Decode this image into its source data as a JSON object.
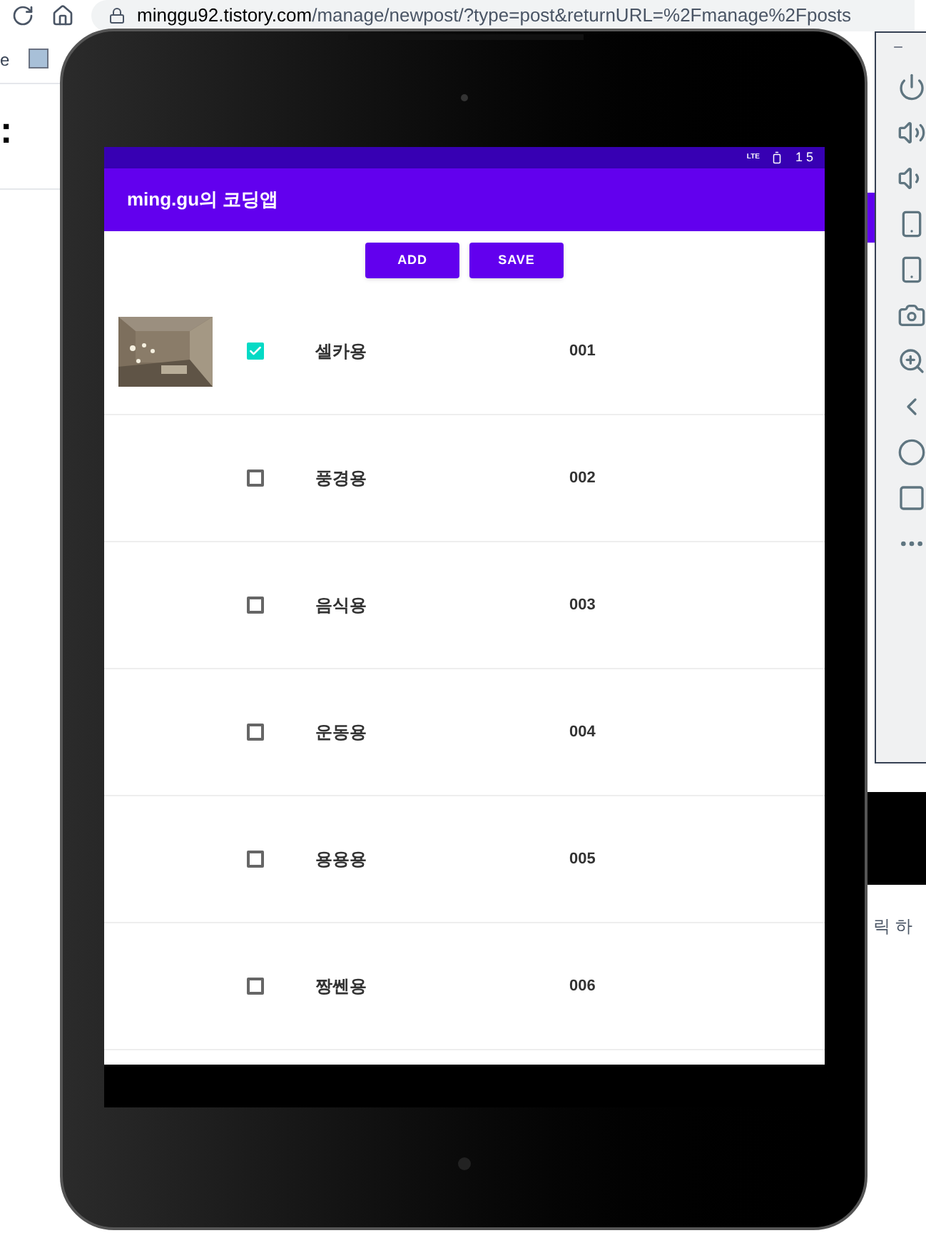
{
  "browser": {
    "url_host": "minggu92.tistory.com",
    "url_path": "/manage/newpost/?type=post&returnURL=%2Fmanage%2Fposts",
    "bookmark": "e"
  },
  "page": {
    "mark": ":",
    "caption": "릭 하"
  },
  "emulator_toolbar": {
    "minimize": "−"
  },
  "status_bar": {
    "network": "LTE",
    "time": "1 5"
  },
  "app_bar": {
    "title": "ming.gu의 코딩앱"
  },
  "buttons": [
    "ADD",
    "SAVE"
  ],
  "rows": [
    {
      "has_photo": true,
      "checked": true,
      "name": "셀카용",
      "code": "001"
    },
    {
      "has_photo": false,
      "checked": false,
      "name": "풍경용",
      "code": "002"
    },
    {
      "has_photo": false,
      "checked": false,
      "name": "음식용",
      "code": "003"
    },
    {
      "has_photo": false,
      "checked": false,
      "name": "운동용",
      "code": "004"
    },
    {
      "has_photo": false,
      "checked": false,
      "name": "용용용",
      "code": "005"
    },
    {
      "has_photo": false,
      "checked": false,
      "name": "짱쎈용",
      "code": "006"
    }
  ]
}
